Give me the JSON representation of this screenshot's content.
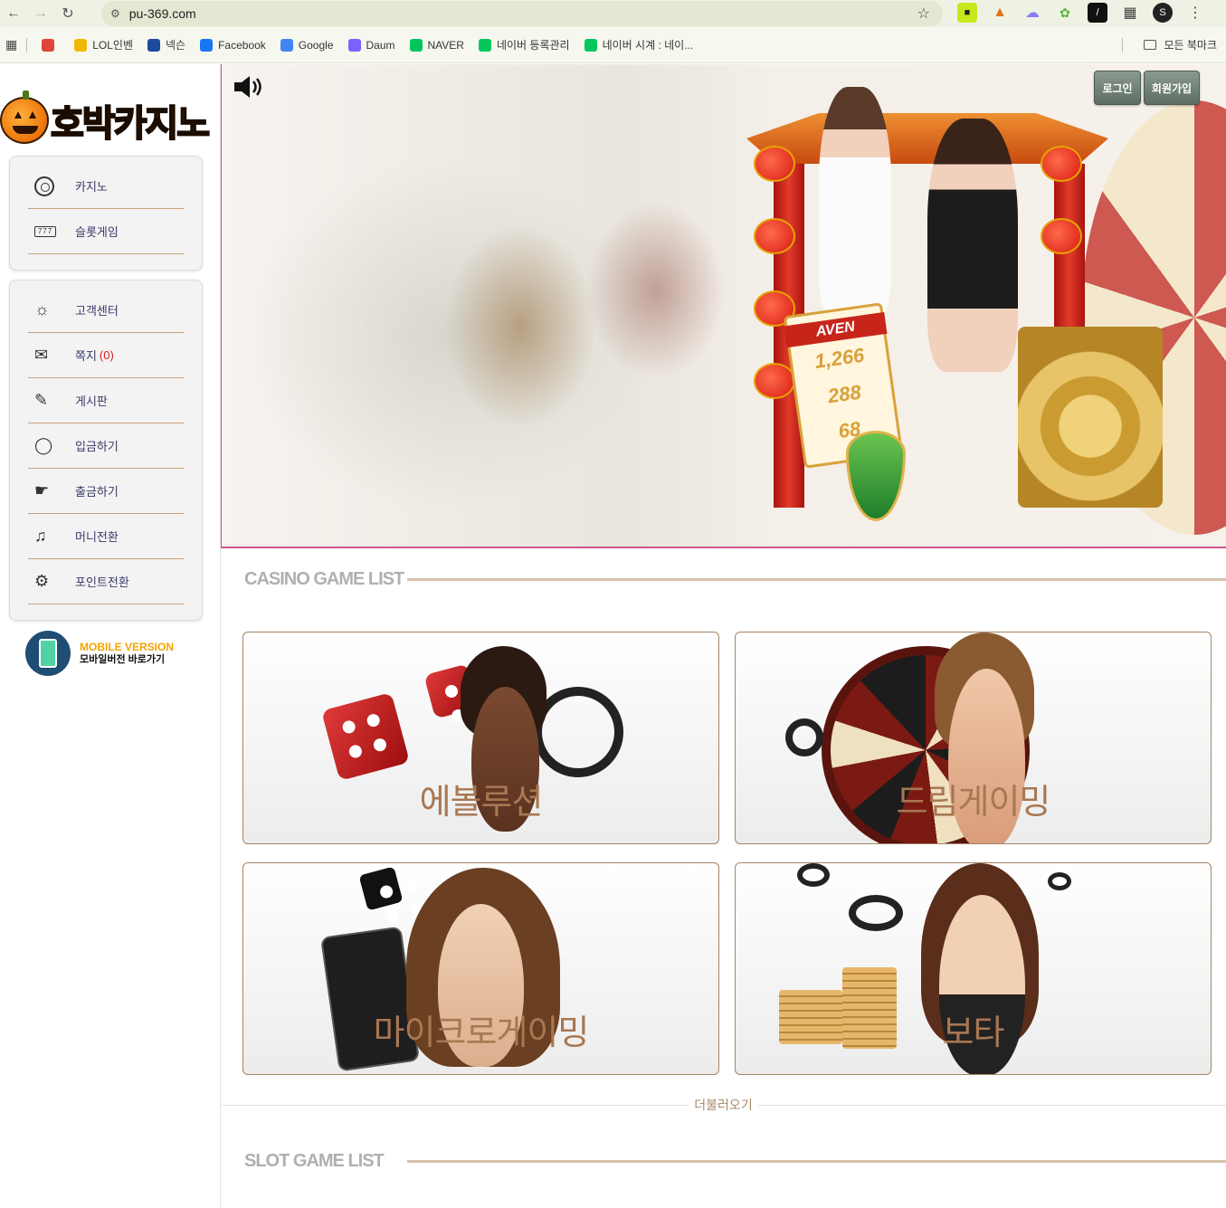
{
  "browser": {
    "url": "pu-369.com",
    "bookmarks": [
      {
        "label": "",
        "icon": "zigzag-icon",
        "color": "#e0443a"
      },
      {
        "label": "LOL인벤",
        "icon": "inven-icon",
        "color": "#f2b705"
      },
      {
        "label": "넥슨",
        "icon": "nexon-icon",
        "color": "#1c4a9c"
      },
      {
        "label": "Facebook",
        "icon": "facebook-icon",
        "color": "#1877f2"
      },
      {
        "label": "Google",
        "icon": "google-icon",
        "color": "#4285f4"
      },
      {
        "label": "Daum",
        "icon": "daum-icon",
        "color": "#7b61ff"
      },
      {
        "label": "NAVER",
        "icon": "naver-icon",
        "color": "#03c75a"
      },
      {
        "label": "네이버 등록관리",
        "icon": "monitor-icon",
        "color": "#03c75a"
      },
      {
        "label": "네이버 시계 : 네이...",
        "icon": "naver-icon",
        "color": "#03c75a"
      }
    ],
    "all_bookmarks": "모든 북마크"
  },
  "sidebar": {
    "logo_text": "호박카지노",
    "group1": [
      {
        "label": "카지노",
        "icon": "casino-chip-icon"
      },
      {
        "label": "슬롯게임",
        "icon": "slot-machine-icon"
      }
    ],
    "group2": [
      {
        "label": "고객센터",
        "icon": "headset-icon"
      },
      {
        "label": "쪽지",
        "icon": "mail-icon",
        "count": "(0)"
      },
      {
        "label": "게시판",
        "icon": "pencil-icon"
      },
      {
        "label": "입금하기",
        "icon": "money-bag-icon"
      },
      {
        "label": "출금하기",
        "icon": "hand-money-icon"
      },
      {
        "label": "머니전환",
        "icon": "bell-icon"
      },
      {
        "label": "포인트전환",
        "icon": "gear-person-icon"
      }
    ],
    "mobile": {
      "title": "MOBILE VERSION",
      "subtitle": "모바일버전 바로가기"
    }
  },
  "banner": {
    "login": "로그인",
    "signup": "회원가입",
    "jackpot_title": "AVEN",
    "jackpot_numbers": [
      "1,266",
      "288",
      "68"
    ]
  },
  "casino": {
    "title": "CASINO GAME LIST",
    "games": [
      "에볼루션",
      "드림게이밍",
      "마이크로게이밍",
      "보타"
    ],
    "load_more": "더불러오기"
  },
  "slot": {
    "title": "SLOT GAME LIST"
  }
}
